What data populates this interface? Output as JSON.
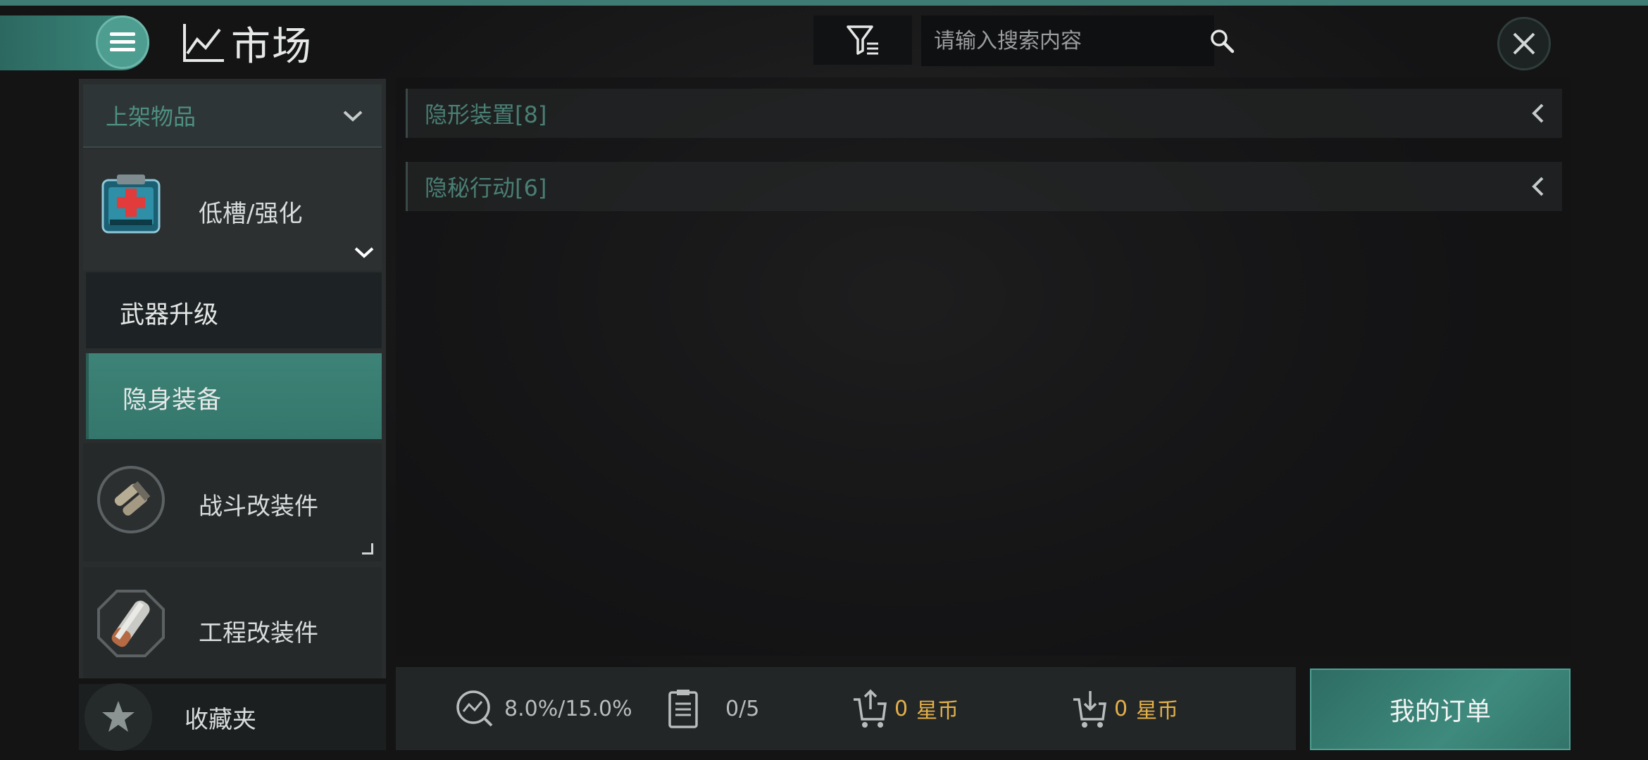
{
  "header": {
    "title": "市场",
    "title_icon": "chart-line-icon",
    "menu_icon": "hamburger-menu-icon",
    "filter_icon": "filter-icon",
    "search": {
      "placeholder": "请输入搜索内容",
      "value": ""
    },
    "search_icon": "search-icon",
    "close_icon": "close-icon"
  },
  "sidebar": {
    "dropdown_label": "上架物品",
    "categories": [
      {
        "label": "低槽/强化",
        "icon": "medkit-module-icon",
        "expanded": true
      },
      {
        "label": "战斗改装件",
        "icon": "combat-rig-icon"
      },
      {
        "label": "工程改装件",
        "icon": "engineering-rig-icon"
      }
    ],
    "subcategories": [
      {
        "label": "武器升级",
        "selected": false
      },
      {
        "label": "隐身装备",
        "selected": true
      }
    ],
    "favorites_label": "收藏夹",
    "favorites_icon": "star-icon"
  },
  "main": {
    "groups": [
      {
        "label": "隐形装置[8]"
      },
      {
        "label": "隐秘行动[6]"
      }
    ]
  },
  "status": {
    "tax_rate": "8.0%/15.0%",
    "orders_count": "0/5",
    "sell_amount": "0",
    "sell_currency": "星币",
    "buy_amount": "0",
    "buy_currency": "星币",
    "my_orders_label": "我的订单"
  },
  "colors": {
    "accent": "#3e8a7d",
    "currency_gold": "#e3b04a",
    "muted_teal": "#4a7f74"
  }
}
